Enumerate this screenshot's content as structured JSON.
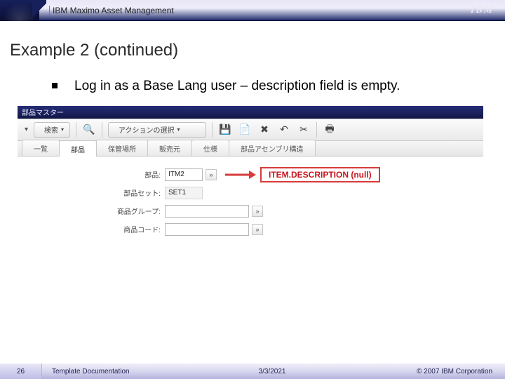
{
  "header": {
    "product_title": "IBM Maximo Asset Management",
    "logo_text": "IBM"
  },
  "slide": {
    "title": "Example 2 (continued)",
    "bullet": "Log in as a Base Lang user – description field is empty."
  },
  "screenshot": {
    "titlebar": "部品マスター",
    "toolbar": {
      "search_label": "検索",
      "action_label": "アクションの選択",
      "icons": [
        "search",
        "save",
        "new",
        "delete",
        "undo",
        "cut",
        "print"
      ]
    },
    "tabs": [
      "一覧",
      "部品",
      "保管場所",
      "販売元",
      "仕様",
      "部品アセンブリ構造"
    ],
    "active_tab_index": 1,
    "fields": {
      "item_label": "部品:",
      "item_value": "ITM2",
      "itemset_label": "部品セット:",
      "itemset_value": "SET1",
      "commoditygroup_label": "商品グループ:",
      "commoditygroup_value": "",
      "commoditycode_label": "商品コード:",
      "commoditycode_value": ""
    },
    "callout_text": "ITEM.DESCRIPTION (null)"
  },
  "footer": {
    "page_number": "26",
    "doc_title": "Template Documentation",
    "date": "3/3/2021",
    "copyright": "© 2007 IBM Corporation"
  }
}
